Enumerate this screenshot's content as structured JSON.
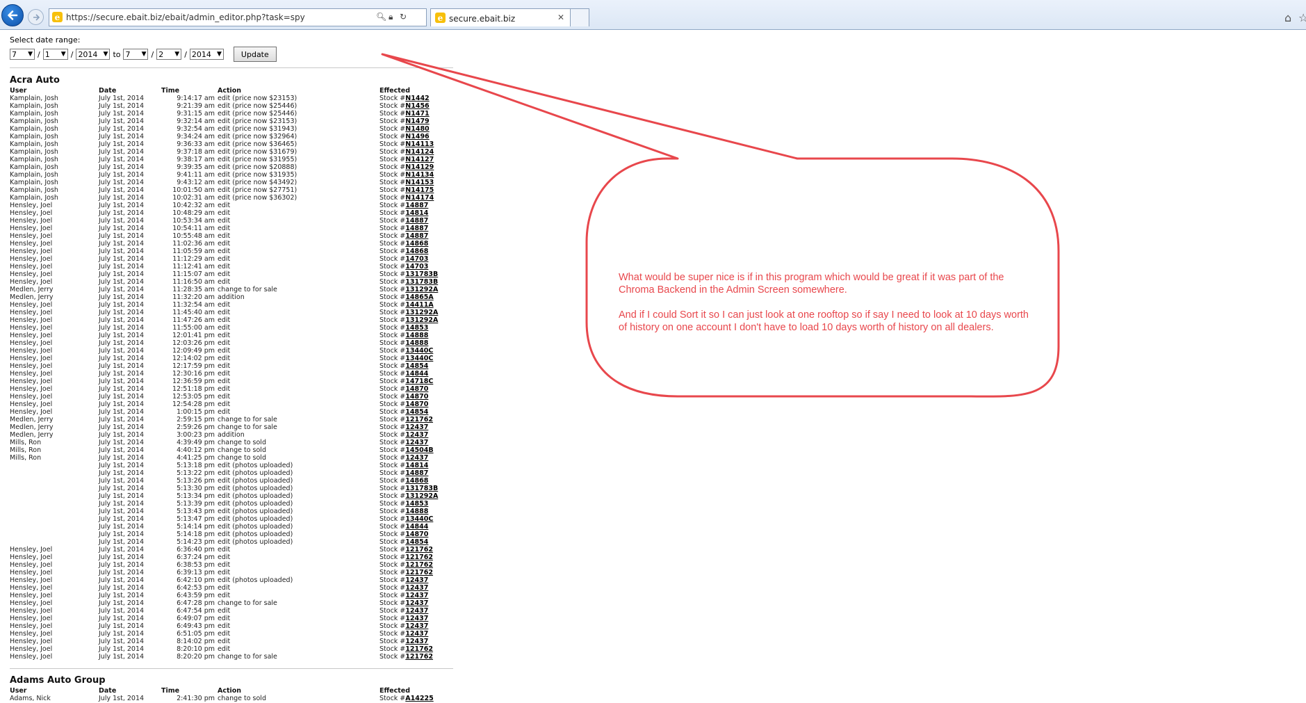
{
  "browser": {
    "url": "https://secure.ebait.biz/ebait/admin_editor.php?task=spy",
    "tab_title": "secure.ebait.biz",
    "favicon_letter": "e"
  },
  "date_range": {
    "label": "Select date range:",
    "from_month": "7",
    "from_day": "1",
    "from_year": "2014",
    "to_word": "to",
    "to_month": "7",
    "to_day": "2",
    "to_year": "2014",
    "separator": "/",
    "update_label": "Update"
  },
  "sections": [
    {
      "title": "Acra Auto",
      "headers": {
        "user": "User",
        "date": "Date",
        "time": "Time",
        "action": "Action",
        "effected": "Effected"
      },
      "stock_prefix": "Stock #",
      "rows": [
        [
          "Kamplain, Josh",
          "July 1st, 2014",
          "9:14:17 am",
          "edit (price now $23153)",
          "N1442"
        ],
        [
          "Kamplain, Josh",
          "July 1st, 2014",
          "9:21:39 am",
          "edit (price now $25446)",
          "N1456"
        ],
        [
          "Kamplain, Josh",
          "July 1st, 2014",
          "9:31:15 am",
          "edit (price now $25446)",
          "N1471"
        ],
        [
          "Kamplain, Josh",
          "July 1st, 2014",
          "9:32:14 am",
          "edit (price now $23153)",
          "N1479"
        ],
        [
          "Kamplain, Josh",
          "July 1st, 2014",
          "9:32:54 am",
          "edit (price now $31943)",
          "N1480"
        ],
        [
          "Kamplain, Josh",
          "July 1st, 2014",
          "9:34:24 am",
          "edit (price now $32964)",
          "N1496"
        ],
        [
          "Kamplain, Josh",
          "July 1st, 2014",
          "9:36:33 am",
          "edit (price now $36465)",
          "N14113"
        ],
        [
          "Kamplain, Josh",
          "July 1st, 2014",
          "9:37:18 am",
          "edit (price now $31679)",
          "N14124"
        ],
        [
          "Kamplain, Josh",
          "July 1st, 2014",
          "9:38:17 am",
          "edit (price now $31955)",
          "N14127"
        ],
        [
          "Kamplain, Josh",
          "July 1st, 2014",
          "9:39:35 am",
          "edit (price now $20888)",
          "N14129"
        ],
        [
          "Kamplain, Josh",
          "July 1st, 2014",
          "9:41:11 am",
          "edit (price now $31935)",
          "N14134"
        ],
        [
          "Kamplain, Josh",
          "July 1st, 2014",
          "9:43:12 am",
          "edit (price now $43492)",
          "N14153"
        ],
        [
          "Kamplain, Josh",
          "July 1st, 2014",
          "10:01:50 am",
          "edit (price now $27751)",
          "N14175"
        ],
        [
          "Kamplain, Josh",
          "July 1st, 2014",
          "10:02:31 am",
          "edit (price now $36302)",
          "N14174"
        ],
        [
          "Hensley, Joel",
          "July 1st, 2014",
          "10:42:32 am",
          "edit",
          "14887"
        ],
        [
          "Hensley, Joel",
          "July 1st, 2014",
          "10:48:29 am",
          "edit",
          "14814"
        ],
        [
          "Hensley, Joel",
          "July 1st, 2014",
          "10:53:34 am",
          "edit",
          "14887"
        ],
        [
          "Hensley, Joel",
          "July 1st, 2014",
          "10:54:11 am",
          "edit",
          "14887"
        ],
        [
          "Hensley, Joel",
          "July 1st, 2014",
          "10:55:48 am",
          "edit",
          "14887"
        ],
        [
          "Hensley, Joel",
          "July 1st, 2014",
          "11:02:36 am",
          "edit",
          "14868"
        ],
        [
          "Hensley, Joel",
          "July 1st, 2014",
          "11:05:59 am",
          "edit",
          "14868"
        ],
        [
          "Hensley, Joel",
          "July 1st, 2014",
          "11:12:29 am",
          "edit",
          "14703"
        ],
        [
          "Hensley, Joel",
          "July 1st, 2014",
          "11:12:41 am",
          "edit",
          "14703"
        ],
        [
          "Hensley, Joel",
          "July 1st, 2014",
          "11:15:07 am",
          "edit",
          "131783B"
        ],
        [
          "Hensley, Joel",
          "July 1st, 2014",
          "11:16:50 am",
          "edit",
          "131783B"
        ],
        [
          "Medlen, Jerry",
          "July 1st, 2014",
          "11:28:35 am",
          "change to for sale",
          "131292A"
        ],
        [
          "Medlen, Jerry",
          "July 1st, 2014",
          "11:32:20 am",
          "addition",
          "14865A"
        ],
        [
          "Hensley, Joel",
          "July 1st, 2014",
          "11:32:54 am",
          "edit",
          "14411A"
        ],
        [
          "Hensley, Joel",
          "July 1st, 2014",
          "11:45:40 am",
          "edit",
          "131292A"
        ],
        [
          "Hensley, Joel",
          "July 1st, 2014",
          "11:47:26 am",
          "edit",
          "131292A"
        ],
        [
          "Hensley, Joel",
          "July 1st, 2014",
          "11:55:00 am",
          "edit",
          "14853"
        ],
        [
          "Hensley, Joel",
          "July 1st, 2014",
          "12:01:41 pm",
          "edit",
          "14888"
        ],
        [
          "Hensley, Joel",
          "July 1st, 2014",
          "12:03:26 pm",
          "edit",
          "14888"
        ],
        [
          "Hensley, Joel",
          "July 1st, 2014",
          "12:09:49 pm",
          "edit",
          "13440C"
        ],
        [
          "Hensley, Joel",
          "July 1st, 2014",
          "12:14:02 pm",
          "edit",
          "13440C"
        ],
        [
          "Hensley, Joel",
          "July 1st, 2014",
          "12:17:59 pm",
          "edit",
          "14854"
        ],
        [
          "Hensley, Joel",
          "July 1st, 2014",
          "12:30:16 pm",
          "edit",
          "14844"
        ],
        [
          "Hensley, Joel",
          "July 1st, 2014",
          "12:36:59 pm",
          "edit",
          "14718C"
        ],
        [
          "Hensley, Joel",
          "July 1st, 2014",
          "12:51:18 pm",
          "edit",
          "14870"
        ],
        [
          "Hensley, Joel",
          "July 1st, 2014",
          "12:53:05 pm",
          "edit",
          "14870"
        ],
        [
          "Hensley, Joel",
          "July 1st, 2014",
          "12:54:28 pm",
          "edit",
          "14870"
        ],
        [
          "Hensley, Joel",
          "July 1st, 2014",
          "1:00:15 pm",
          "edit",
          "14854"
        ],
        [
          "Medlen, Jerry",
          "July 1st, 2014",
          "2:59:15 pm",
          "change to for sale",
          "121762"
        ],
        [
          "Medlen, Jerry",
          "July 1st, 2014",
          "2:59:26 pm",
          "change to for sale",
          "12437"
        ],
        [
          "Medlen, Jerry",
          "July 1st, 2014",
          "3:00:23 pm",
          "addition",
          "12437"
        ],
        [
          "Mills, Ron",
          "July 1st, 2014",
          "4:39:49 pm",
          "change to sold",
          "12437"
        ],
        [
          "Mills, Ron",
          "July 1st, 2014",
          "4:40:12 pm",
          "change to sold",
          "14504B"
        ],
        [
          "Mills, Ron",
          "July 1st, 2014",
          "4:41:25 pm",
          "change to sold",
          "12437"
        ],
        [
          "",
          "July 1st, 2014",
          "5:13:18 pm",
          "edit (photos uploaded)",
          "14814"
        ],
        [
          "",
          "July 1st, 2014",
          "5:13:22 pm",
          "edit (photos uploaded)",
          "14887"
        ],
        [
          "",
          "July 1st, 2014",
          "5:13:26 pm",
          "edit (photos uploaded)",
          "14868"
        ],
        [
          "",
          "July 1st, 2014",
          "5:13:30 pm",
          "edit (photos uploaded)",
          "131783B"
        ],
        [
          "",
          "July 1st, 2014",
          "5:13:34 pm",
          "edit (photos uploaded)",
          "131292A"
        ],
        [
          "",
          "July 1st, 2014",
          "5:13:39 pm",
          "edit (photos uploaded)",
          "14853"
        ],
        [
          "",
          "July 1st, 2014",
          "5:13:43 pm",
          "edit (photos uploaded)",
          "14888"
        ],
        [
          "",
          "July 1st, 2014",
          "5:13:47 pm",
          "edit (photos uploaded)",
          "13440C"
        ],
        [
          "",
          "July 1st, 2014",
          "5:14:14 pm",
          "edit (photos uploaded)",
          "14844"
        ],
        [
          "",
          "July 1st, 2014",
          "5:14:18 pm",
          "edit (photos uploaded)",
          "14870"
        ],
        [
          "",
          "July 1st, 2014",
          "5:14:23 pm",
          "edit (photos uploaded)",
          "14854"
        ],
        [
          "Hensley, Joel",
          "July 1st, 2014",
          "6:36:40 pm",
          "edit",
          "121762"
        ],
        [
          "Hensley, Joel",
          "July 1st, 2014",
          "6:37:24 pm",
          "edit",
          "121762"
        ],
        [
          "Hensley, Joel",
          "July 1st, 2014",
          "6:38:53 pm",
          "edit",
          "121762"
        ],
        [
          "Hensley, Joel",
          "July 1st, 2014",
          "6:39:13 pm",
          "edit",
          "121762"
        ],
        [
          "Hensley, Joel",
          "July 1st, 2014",
          "6:42:10 pm",
          "edit (photos uploaded)",
          "12437"
        ],
        [
          "Hensley, Joel",
          "July 1st, 2014",
          "6:42:53 pm",
          "edit",
          "12437"
        ],
        [
          "Hensley, Joel",
          "July 1st, 2014",
          "6:43:59 pm",
          "edit",
          "12437"
        ],
        [
          "Hensley, Joel",
          "July 1st, 2014",
          "6:47:28 pm",
          "change to for sale",
          "12437"
        ],
        [
          "Hensley, Joel",
          "July 1st, 2014",
          "6:47:54 pm",
          "edit",
          "12437"
        ],
        [
          "Hensley, Joel",
          "July 1st, 2014",
          "6:49:07 pm",
          "edit",
          "12437"
        ],
        [
          "Hensley, Joel",
          "July 1st, 2014",
          "6:49:43 pm",
          "edit",
          "12437"
        ],
        [
          "Hensley, Joel",
          "July 1st, 2014",
          "6:51:05 pm",
          "edit",
          "12437"
        ],
        [
          "Hensley, Joel",
          "July 1st, 2014",
          "8:14:02 pm",
          "edit",
          "12437"
        ],
        [
          "Hensley, Joel",
          "July 1st, 2014",
          "8:20:10 pm",
          "edit",
          "121762"
        ],
        [
          "Hensley, Joel",
          "July 1st, 2014",
          "8:20:20 pm",
          "change to for sale",
          "121762"
        ]
      ]
    },
    {
      "title": "Adams Auto Group",
      "headers": {
        "user": "User",
        "date": "Date",
        "time": "Time",
        "action": "Action",
        "effected": "Effected"
      },
      "stock_prefix": "Stock #",
      "rows": [
        [
          "Adams, Nick",
          "July 1st, 2014",
          "2:41:30 pm",
          "change to sold",
          "A14225"
        ]
      ]
    }
  ],
  "annotation": {
    "paragraph_1": "What would be super nice is if in this program which would be great if it was part of the Chroma Backend in the Admin Screen somewhere.",
    "paragraph_2": "And if I could Sort it so I can just look at one rooftop so if say I need to look at 10 days worth of history on one account I don't have to load 10 days worth of history on all dealers.",
    "color": "#e8474c"
  }
}
